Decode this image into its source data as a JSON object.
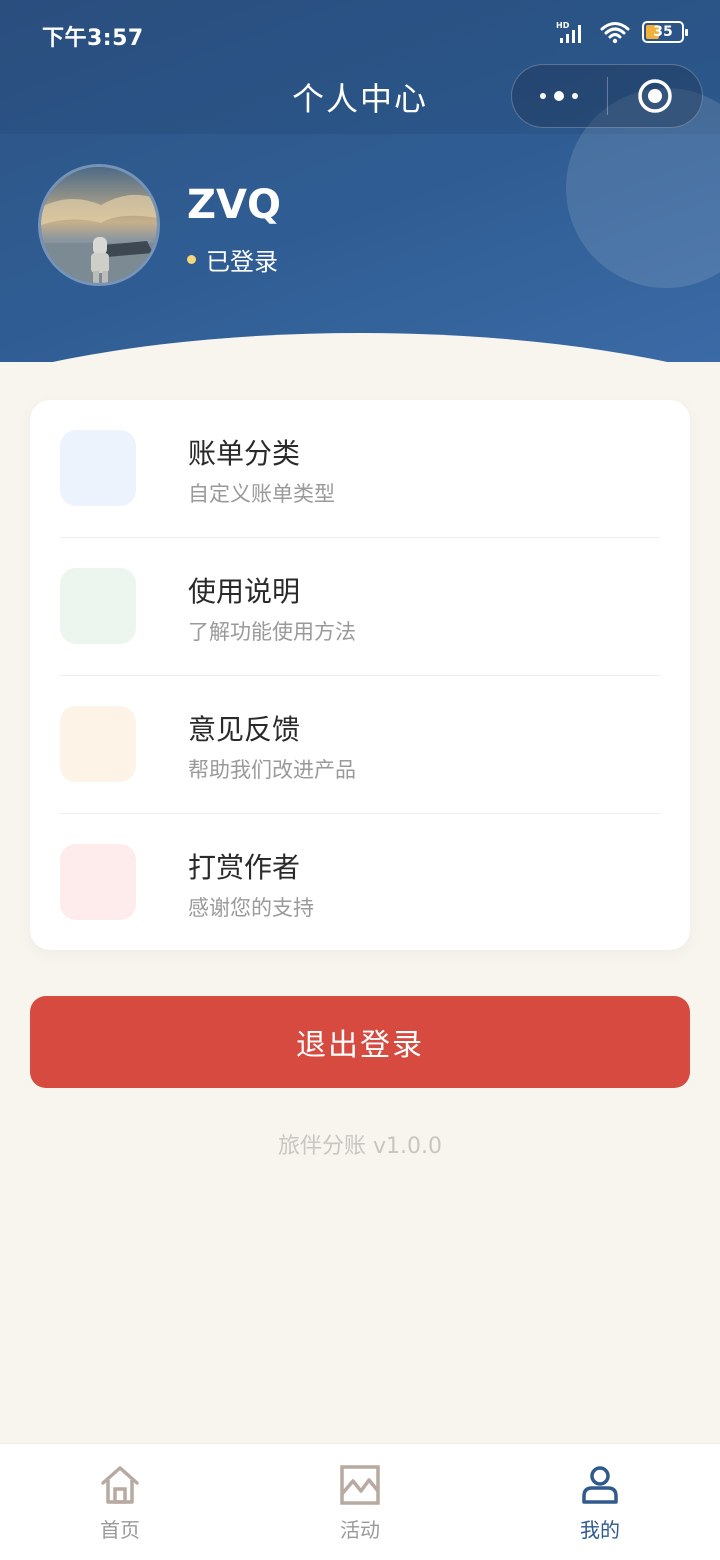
{
  "status_bar": {
    "time": "下午3:57",
    "network_label": "HD",
    "battery_level": "35"
  },
  "nav": {
    "title": "个人中心"
  },
  "profile": {
    "username": "ZVQ",
    "login_status": "已登录"
  },
  "menu": {
    "items": [
      {
        "title": "账单分类",
        "subtitle": "自定义账单类型",
        "icon_color": "#edf3fd"
      },
      {
        "title": "使用说明",
        "subtitle": "了解功能使用方法",
        "icon_color": "#ecf5ee"
      },
      {
        "title": "意见反馈",
        "subtitle": "帮助我们改进产品",
        "icon_color": "#fdf3e6"
      },
      {
        "title": "打赏作者",
        "subtitle": "感谢您的支持",
        "icon_color": "#fdeceb"
      }
    ]
  },
  "logout_label": "退出登录",
  "version": "旅伴分账 v1.0.0",
  "tabbar": {
    "items": [
      {
        "label": "首页",
        "icon": "home-icon",
        "active": false
      },
      {
        "label": "活动",
        "icon": "activity-chart-icon",
        "active": false
      },
      {
        "label": "我的",
        "icon": "user-icon",
        "active": true
      }
    ]
  },
  "colors": {
    "header": "#2f5a8e",
    "background": "#f8f4ee",
    "logout": "#d64a40",
    "active_tab": "#2f5a8e",
    "inactive_tab": "#9a9a9a"
  }
}
